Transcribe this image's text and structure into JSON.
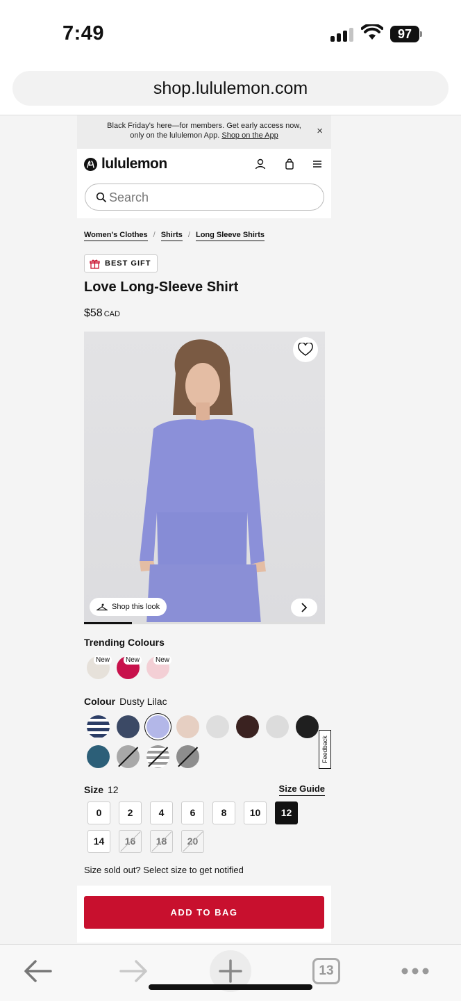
{
  "status_bar": {
    "time": "7:49",
    "battery": "97",
    "icons": [
      "cellular-signal-icon",
      "wifi-icon",
      "battery-icon"
    ]
  },
  "browser": {
    "url": "shop.lululemon.com",
    "tab_count": "13",
    "icons": [
      "back-arrow-icon",
      "forward-arrow-icon",
      "new-tab-plus-icon",
      "tabs-icon",
      "more-dots-icon"
    ]
  },
  "promo": {
    "line1": "Black Friday's here—for members. Get early access now,",
    "line2_prefix": "only on the lululemon App. ",
    "link": "Shop on the App",
    "close": "×"
  },
  "header": {
    "logo_text": "lululemon",
    "search_placeholder": "Search",
    "icons": [
      "logo-icon",
      "account-icon",
      "bag-icon",
      "menu-icon"
    ]
  },
  "breadcrumbs": [
    "Women's Clothes",
    "/",
    "Shirts",
    "/",
    "Long Sleeve Shirts"
  ],
  "product": {
    "badge": "BEST GIFT",
    "title": "Love Long-Sleeve Shirt",
    "price": "$58",
    "currency": "CAD",
    "shop_look": "Shop this look",
    "gallery_progress": 0.2
  },
  "trending": {
    "label": "Trending Colours",
    "new_tag": "New",
    "swatches": [
      {
        "name": "trending-swatch-1",
        "color": "#e6e1da"
      },
      {
        "name": "trending-swatch-2",
        "color": "#c8124c"
      },
      {
        "name": "trending-swatch-3",
        "color": "#f3cfd5"
      }
    ]
  },
  "colour": {
    "label": "Colour",
    "selected": "Dusty Lilac",
    "swatches": [
      "#2b3d66",
      "#3b4965",
      "#b3b7e8",
      "#e6cfc2",
      "#dedede",
      "#3a2220",
      "#dcdcdc",
      "#1f1f1f",
      "#2c5f78",
      "#a8a8a8",
      "#bdbdbd",
      "#8d8d8d"
    ]
  },
  "size": {
    "label": "Size",
    "selected": "12",
    "guide": "Size Guide",
    "options": [
      {
        "v": "0",
        "s": ""
      },
      {
        "v": "2",
        "s": ""
      },
      {
        "v": "4",
        "s": ""
      },
      {
        "v": "6",
        "s": ""
      },
      {
        "v": "8",
        "s": ""
      },
      {
        "v": "10",
        "s": ""
      },
      {
        "v": "12",
        "s": "sel"
      },
      {
        "v": "14",
        "s": ""
      },
      {
        "v": "16",
        "s": "sold"
      },
      {
        "v": "18",
        "s": "sold"
      },
      {
        "v": "20",
        "s": "sold"
      }
    ],
    "sold_out_text": "Size sold out? Select size to get notified"
  },
  "cta": {
    "add_to_bag": "ADD TO BAG"
  },
  "feedback": "Feedback",
  "colors": {
    "brand_red": "#c8102e"
  }
}
